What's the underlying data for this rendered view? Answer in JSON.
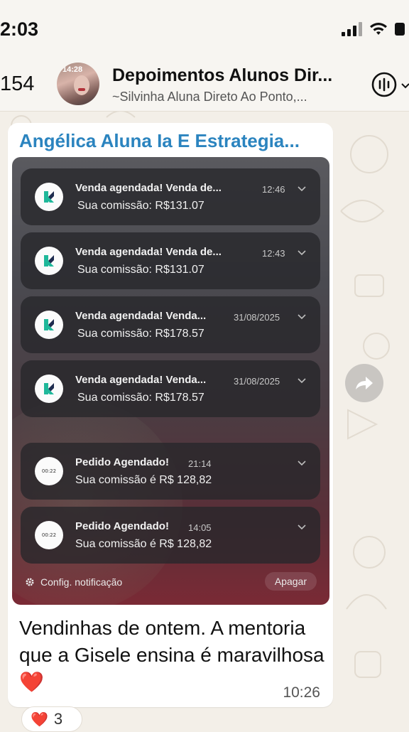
{
  "status_bar": {
    "time": "2:03"
  },
  "header": {
    "back_count": "154",
    "title": "Depoimentos Alunos Dir...",
    "subtitle": "~Silvinha Aluna Direto Ao Ponto,...",
    "avatar_time": "14:28"
  },
  "message": {
    "sender": "Angélica Aluna Ia E Estrategia...",
    "notifications": [
      {
        "title": "Venda agendada! Venda de...",
        "time": "12:46",
        "body": "Sua comissão: R$131.07",
        "icon": "k-logo-icon"
      },
      {
        "title": "Venda agendada! Venda de...",
        "time": "12:43",
        "body": "Sua comissão: R$131.07",
        "icon": "k-logo-icon"
      },
      {
        "title": "Venda agendada! Venda...",
        "time": "31/08/2025",
        "body": "Sua comissão: R$178.57",
        "icon": "k-logo-icon"
      },
      {
        "title": "Venda agendada! Venda...",
        "time": "31/08/2025",
        "body": "Sua comissão: R$178.57",
        "icon": "k-logo-icon"
      },
      {
        "title": "Pedido Agendado!",
        "time": "21:14",
        "body": "Sua comissão é R$ 128,82",
        "icon": "clock-badge-icon",
        "badge": "00:22"
      },
      {
        "title": "Pedido Agendado!",
        "time": "14:05",
        "body": "Sua comissão é R$ 128,82",
        "icon": "clock-badge-icon",
        "badge": "00:22"
      }
    ],
    "settings_label": "Config. notificação",
    "clear_label": "Apagar",
    "caption": "Vendinhas de ontem. A mentoria que a Gisele ensina é maravilhosa❤️",
    "time": "10:26",
    "reaction": {
      "emoji": "❤️",
      "count": "3"
    }
  },
  "colors": {
    "sender": "#2b84bf",
    "wallpaper": "#f3efe8",
    "logo_green": "#1fb89a",
    "logo_navy": "#1d2b4e"
  }
}
